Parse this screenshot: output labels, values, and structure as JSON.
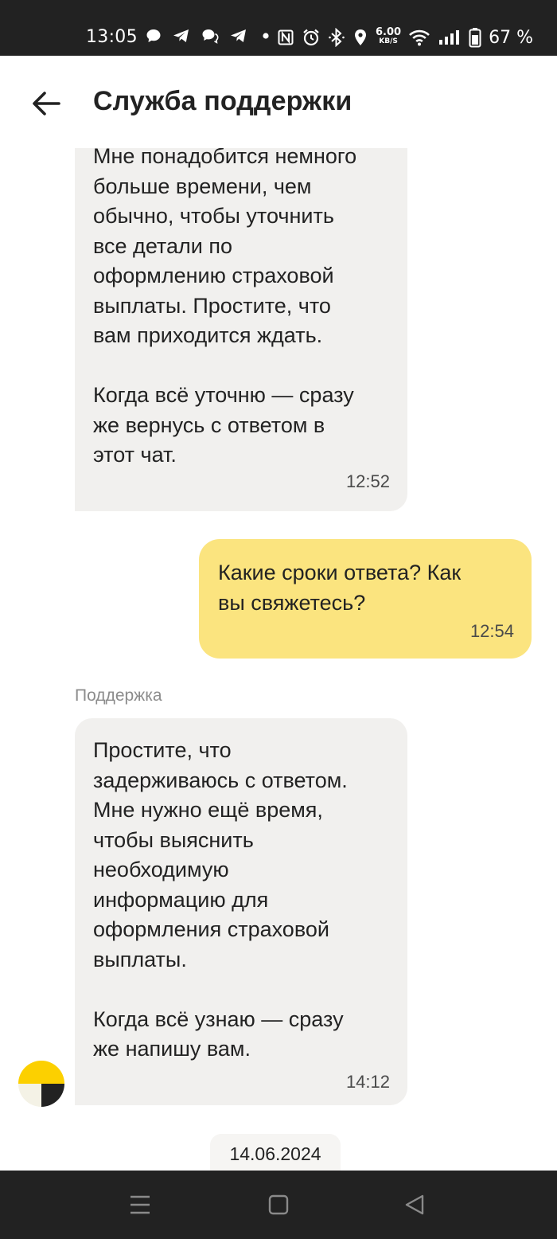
{
  "status_bar": {
    "time": "13:05",
    "notification_icons": [
      "chat-bubble-icon",
      "telegram-icon",
      "chat-bubbles-icon",
      "telegram-icon",
      "dot-icon"
    ],
    "system_icons": [
      "nfc-icon",
      "alarm-icon",
      "bluetooth-icon",
      "location-icon",
      "wifi-icon",
      "signal-icon",
      "battery-icon"
    ],
    "net_speed": "6.00",
    "net_unit": "KB/S",
    "battery": "67 %"
  },
  "header": {
    "back_icon": "arrow-left-icon",
    "title": "Служба поддержки"
  },
  "chat": {
    "messages": [
      {
        "from": "support",
        "text": "Мне понадобится немного\nбольше времени, чем\nобычно, чтобы уточнить\nвсе детали по\nоформлению страховой\nвыплаты. Простите, что\nвам приходится ждать.\n\nКогда всё уточню — сразу\nже вернусь с ответом в\nэтот чат.",
        "time": "12:52"
      },
      {
        "from": "user",
        "text": "Какие сроки ответа? Как\nвы свяжетесь?",
        "time": "12:54"
      },
      {
        "from": "support",
        "sender": "Поддержка",
        "text": "Простите, что\nзадерживаюсь с ответом.\nМне нужно ещё время,\nчтобы выяснить\nнеобходимую\nинформацию для\nоформления страховой\nвыплаты.\n\nКогда всё узнаю — сразу\nже напишу вам.",
        "time": "14:12"
      }
    ],
    "date_separator": "14.06.2024",
    "avatar_colors": {
      "top": "#fcd000",
      "bottom_left": "#f4f2e6",
      "bottom_right": "#222222"
    }
  },
  "nav_bar": {
    "icons": [
      "recent-apps-icon",
      "home-icon",
      "back-triangle-icon"
    ]
  },
  "colors": {
    "status_bar_bg": "#222222",
    "incoming_bubble": "#f1f0ee",
    "outgoing_bubble": "#fbe47f"
  }
}
